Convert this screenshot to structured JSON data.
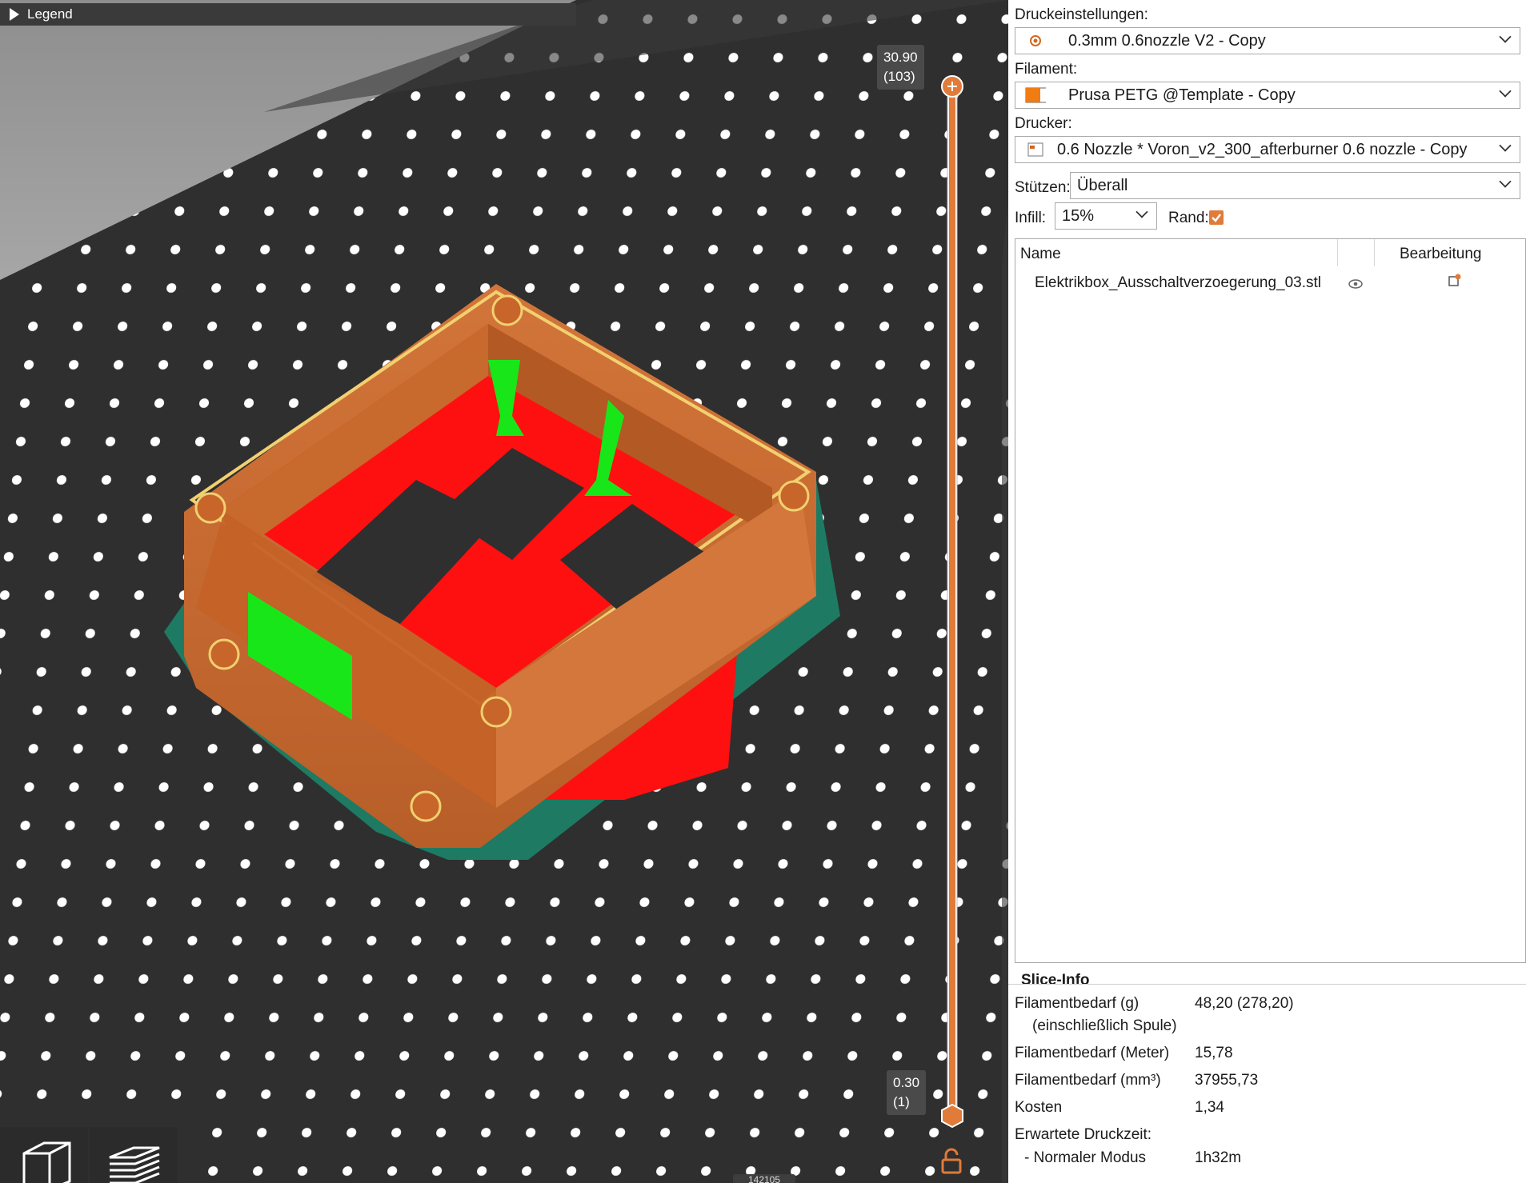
{
  "viewport": {
    "legend_label": "Legend",
    "slider_top": {
      "height": "30.90",
      "layer": "(103)"
    },
    "slider_bottom": {
      "height": "0.30",
      "layer": "(1)"
    },
    "bottom_counter": "142105",
    "colors": {
      "bed": "#2f2f2f",
      "perimeter": "#c8652a",
      "infill": "#ff1010",
      "support": "#19e619",
      "skirt": "#1e7a63",
      "slider": "#e07b39"
    }
  },
  "panel": {
    "print_settings": {
      "label": "Druckeinstellungen:",
      "value": "0.3mm 0.6nozzle V2 - Copy",
      "icon": "gear-icon"
    },
    "filament": {
      "label": "Filament:",
      "value": "Prusa PETG @Template - Copy",
      "icon": "filament-swatch-icon",
      "color": "#f07c14"
    },
    "printer": {
      "label": "Drucker:",
      "value": "0.6 Nozzle * Voron_v2_300_afterburner 0.6 nozzle - Copy",
      "icon": "printer-icon"
    },
    "supports": {
      "label": "Stützen:",
      "value": "Überall"
    },
    "infill": {
      "label": "Infill:",
      "value": "15%"
    },
    "brim": {
      "label": "Rand:",
      "checked": true
    },
    "objects": {
      "col_name": "Name",
      "col_edit": "Bearbeitung",
      "rows": [
        {
          "name": "Elektrikbox_Ausschaltverzoegerung_03.stl"
        }
      ]
    },
    "slice_info": {
      "title": "Slice-Info",
      "rows": [
        {
          "label": "Filamentbedarf (g)",
          "sub": "(einschließlich Spule)",
          "value": "48,20 (278,20)"
        },
        {
          "label": "Filamentbedarf (Meter)",
          "value": "15,78"
        },
        {
          "label": "Filamentbedarf (mm³)",
          "value": "37955,73"
        },
        {
          "label": "Kosten",
          "value": "1,34"
        },
        {
          "label": "Erwartete Druckzeit:",
          "value": ""
        },
        {
          "label": "- Normaler Modus",
          "value": "1h32m"
        }
      ]
    }
  }
}
